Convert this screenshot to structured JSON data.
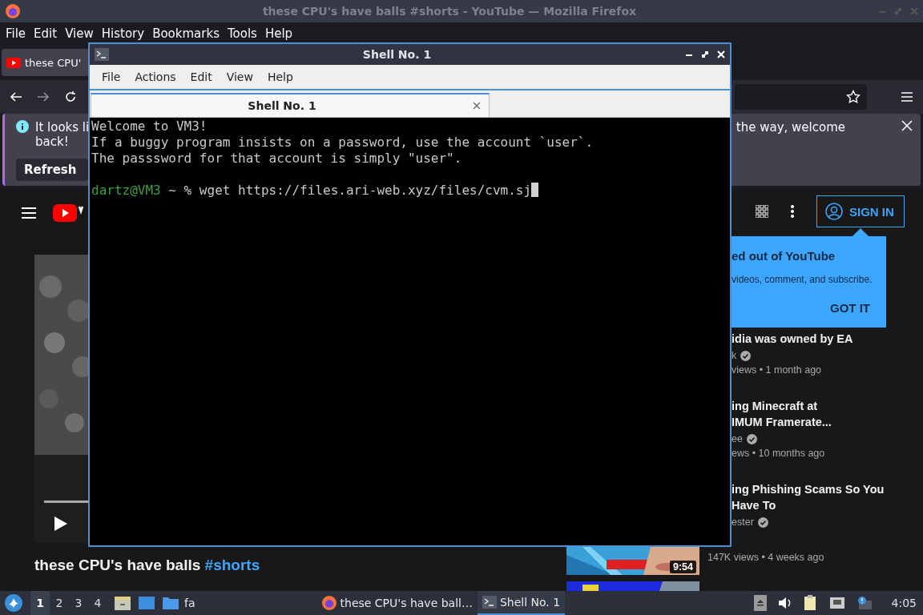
{
  "firefox": {
    "title": "these CPU's have balls #shorts - YouTube — Mozilla Firefox",
    "menu": [
      "File",
      "Edit",
      "View",
      "History",
      "Bookmarks",
      "Tools",
      "Help"
    ],
    "tab": {
      "title": "these CPU'"
    },
    "notification": {
      "text_left": "It looks li",
      "text_left_2": "back!",
      "text_right": "the way, welcome",
      "button": "Refresh"
    },
    "youtube": {
      "sign_in": "SIGN IN",
      "popup": {
        "title": "ed out of YouTube",
        "text": "videos, comment, and subscribe.",
        "button": "GOT IT"
      },
      "recommendations": [
        {
          "title_lines": [
            "idia was owned by EA"
          ],
          "channel": "k",
          "verified": true,
          "meta": "views • 1 month ago"
        },
        {
          "title_lines": [
            "ing Minecraft at",
            "IMUM Framerate..."
          ],
          "channel": "ee",
          "verified": true,
          "meta": "ews • 10 months ago"
        },
        {
          "title_lines": [
            "ing Phishing Scams So You",
            "Have To"
          ],
          "channel": "ester",
          "verified": true
        }
      ],
      "bottom_meta": "147K views • 4 weeks ago",
      "duration": "9:54",
      "video_title": "these CPU's have balls ",
      "video_hashtag": "#shorts"
    }
  },
  "terminal": {
    "title": "Shell No. 1",
    "menu": [
      "File",
      "Actions",
      "Edit",
      "View",
      "Help"
    ],
    "tab": "Shell No. 1",
    "lines": [
      "Welcome to VM3!",
      "If a buggy program insists on a password, use the account `user`.",
      "The passsword for that account is simply \"user\"."
    ],
    "prompt_user": "dartz@VM3",
    "prompt_rest": " ~ % wget https://files.ari-web.xyz/files/cvm.sj"
  },
  "taskbar": {
    "workspaces": [
      {
        "label": "1",
        "selected": true
      },
      {
        "label": "2",
        "selected": false
      },
      {
        "label": "3",
        "selected": false
      },
      {
        "label": "4",
        "selected": false
      }
    ],
    "folder": "fa",
    "tasks": [
      {
        "kind": "browser",
        "label": "these CPU's have ball…",
        "selected": false
      },
      {
        "kind": "terminal",
        "label": "Shell No. 1",
        "selected": true
      }
    ],
    "clock": "4:05"
  }
}
